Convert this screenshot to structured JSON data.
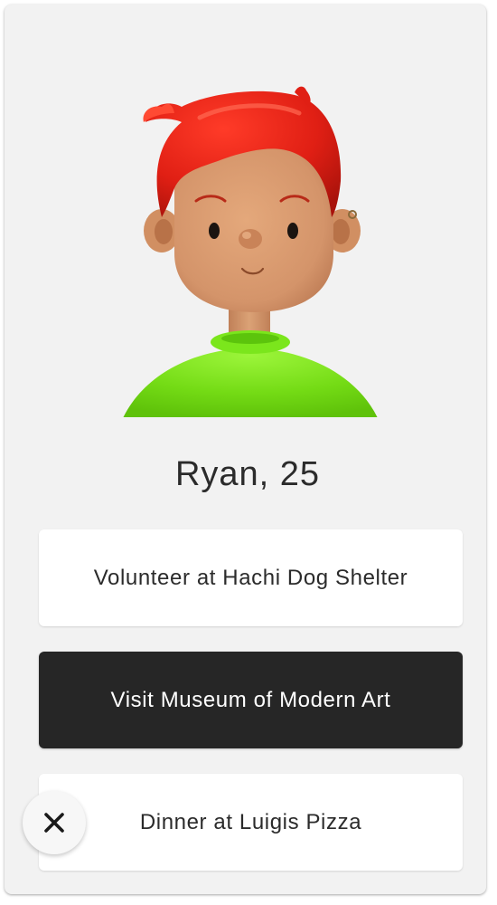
{
  "profile": {
    "name_age": "Ryan, 25",
    "avatar_icon": "avatar-illustration"
  },
  "options": [
    {
      "label": "Volunteer at Hachi Dog Shelter",
      "style": "light"
    },
    {
      "label": "Visit Museum of Modern Art",
      "style": "dark"
    },
    {
      "label": "Dinner at Luigis Pizza",
      "style": "light"
    }
  ],
  "close_button": {
    "icon": "close-icon"
  },
  "colors": {
    "card_background": "#f2f2f2",
    "option_light": "#ffffff",
    "option_dark": "#262626",
    "hair": "#e01f14",
    "skin": "#d99a6c",
    "shirt": "#7ee21a"
  }
}
